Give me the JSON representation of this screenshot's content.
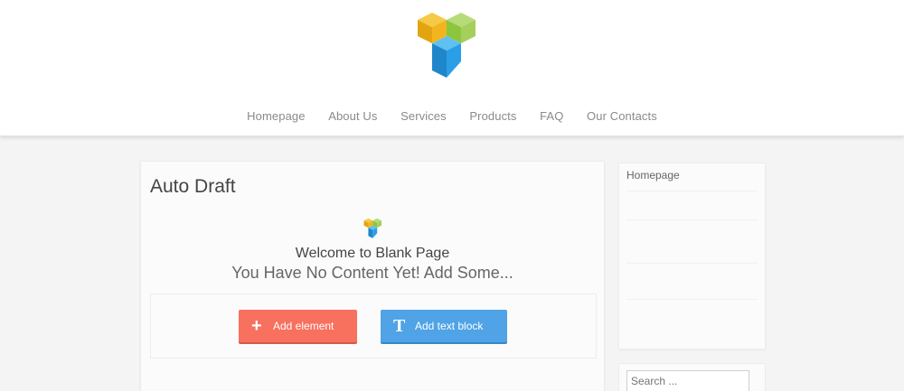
{
  "site": {
    "logo_icon": "cube-logo-icon",
    "colors": {
      "yellow": "#f2b51d",
      "green": "#8cc63f",
      "blue": "#2a9ee6"
    }
  },
  "nav": {
    "items": [
      "Homepage",
      "About Us",
      "Services",
      "Products",
      "FAQ",
      "Our Contacts"
    ]
  },
  "main": {
    "title": "Auto Draft",
    "welcome": "Welcome to Blank Page",
    "subtitle": "You Have No Content Yet! Add Some...",
    "buttons": {
      "add_element": {
        "icon": "+",
        "label": "Add element",
        "color": "#f8705e"
      },
      "add_text_block": {
        "icon": "T",
        "label": "Add text block",
        "color": "#4fa3e6"
      }
    }
  },
  "sidebar": {
    "link": "Homepage",
    "search_placeholder": "Search ..."
  }
}
